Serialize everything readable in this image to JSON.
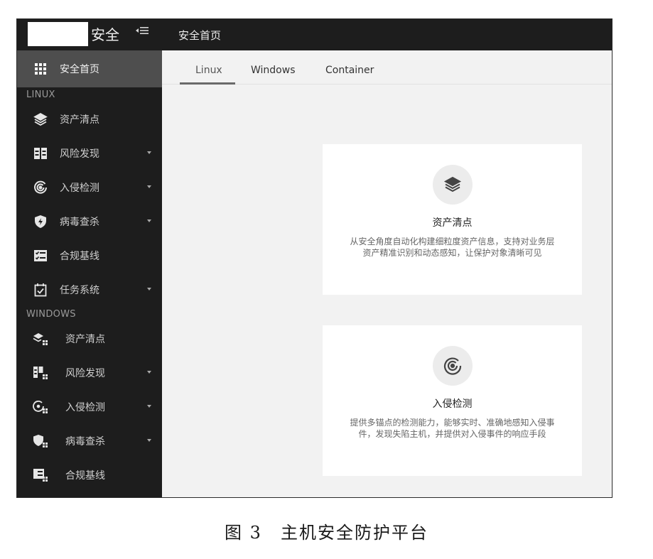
{
  "app": {
    "title": "安全",
    "collapse_icon": "menu-fold-icon"
  },
  "topbar": {
    "title": "安全首页"
  },
  "sidebar": {
    "home": {
      "label": "安全首页",
      "icon": "grid-icon"
    },
    "linux_group": "LINUX",
    "linux_items": [
      {
        "label": "资产清点",
        "icon": "layers-icon"
      },
      {
        "label": "风险发现",
        "icon": "columns-icon",
        "caret": true
      },
      {
        "label": "入侵检测",
        "icon": "radar-icon",
        "caret": true
      },
      {
        "label": "病毒查杀",
        "icon": "shield-icon",
        "caret": true
      },
      {
        "label": "合规基线",
        "icon": "checklist-icon"
      },
      {
        "label": "任务系统",
        "icon": "calendar-check-icon",
        "caret": true
      }
    ],
    "windows_group": "WINDOWS",
    "windows_items": [
      {
        "label": "资产清点",
        "icon": "layers-windows-icon"
      },
      {
        "label": "风险发现",
        "icon": "columns-windows-icon",
        "caret": true
      },
      {
        "label": "入侵检测",
        "icon": "radar-windows-icon",
        "caret": true
      },
      {
        "label": "病毒查杀",
        "icon": "shield-windows-icon",
        "caret": true
      },
      {
        "label": "合规基线",
        "icon": "checklist-windows-icon"
      }
    ]
  },
  "tabs": [
    {
      "label": "Linux",
      "active": true
    },
    {
      "label": "Windows",
      "active": false
    },
    {
      "label": "Container",
      "active": false
    }
  ],
  "cards": [
    {
      "title": "资产清点",
      "icon": "layers-icon",
      "desc": "从安全角度自动化构建细粒度资产信息，支持对业务层资产精准识别和动态感知，让保护对象清晰可见"
    },
    {
      "title": "入侵检测",
      "icon": "radar-icon",
      "desc": "提供多锚点的检测能力，能够实时、准确地感知入侵事件，发现失陷主机，并提供对入侵事件的响应手段"
    }
  ],
  "caption": "图 3　主机安全防护平台"
}
